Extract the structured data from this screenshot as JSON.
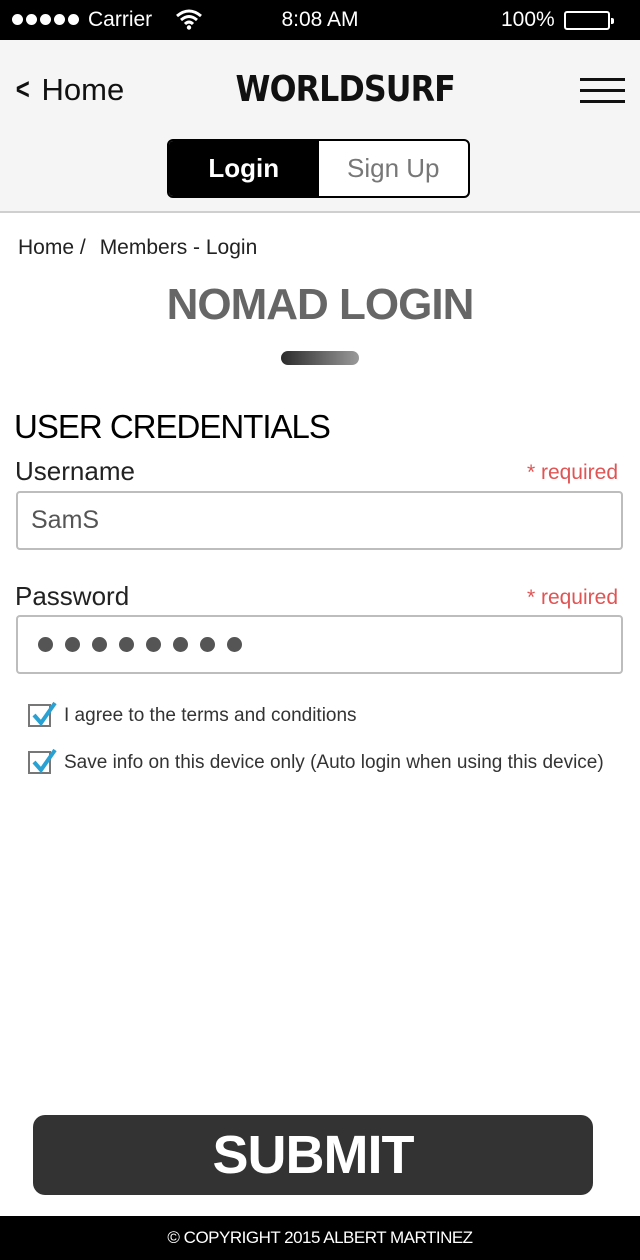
{
  "status_bar": {
    "carrier": "Carrier",
    "time": "8:08 AM",
    "battery": "100%"
  },
  "header": {
    "back_label": "Home",
    "logo": "WORLDSURF",
    "tabs": [
      {
        "label": "Login",
        "active": true
      },
      {
        "label": "Sign Up",
        "active": false
      }
    ]
  },
  "breadcrumb": {
    "items": [
      "Home /",
      "Members - Login"
    ]
  },
  "page": {
    "title": "NOMAD LOGIN"
  },
  "form": {
    "section_title": "USER CREDENTIALS",
    "username": {
      "label": "Username",
      "required": "* required",
      "value": "SamS"
    },
    "password": {
      "label": "Password",
      "required": "* required",
      "masked_length": 8
    },
    "checkboxes": [
      {
        "label": "I agree to the terms and conditions",
        "checked": true
      },
      {
        "label": "Save info on this device only (Auto login when using this device)",
        "checked": true
      }
    ],
    "submit_label": "SUBMIT"
  },
  "footer": {
    "copyright": "© COPYRIGHT 2015 ALBERT MARTINEZ"
  },
  "colors": {
    "accent_check": "#2aa1d3",
    "required": "#e05454",
    "submit_bg": "#333333"
  }
}
